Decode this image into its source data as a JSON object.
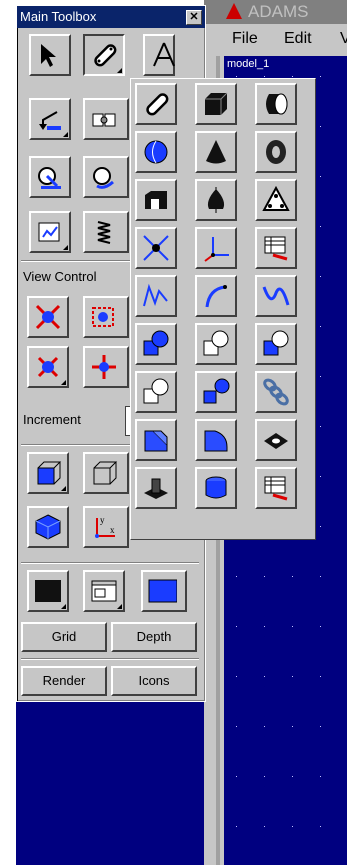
{
  "toolbox": {
    "title": "Main Toolbox",
    "close_glyph": "✕",
    "view_control_label": "View Control",
    "increment_label": "Increment",
    "grid_label": "Grid",
    "depth_label": "Depth",
    "render_label": "Render",
    "icons_label": "Icons"
  },
  "adams": {
    "title": "ADAMS",
    "menu_file": "File",
    "menu_edit": "Edit",
    "menu_view": "V",
    "model_name": "model_1"
  },
  "colors": {
    "titlebar": "#0a246a",
    "canvas": "#000080",
    "face": "#c6c6c6",
    "icon_blue": "#1a3cff"
  }
}
